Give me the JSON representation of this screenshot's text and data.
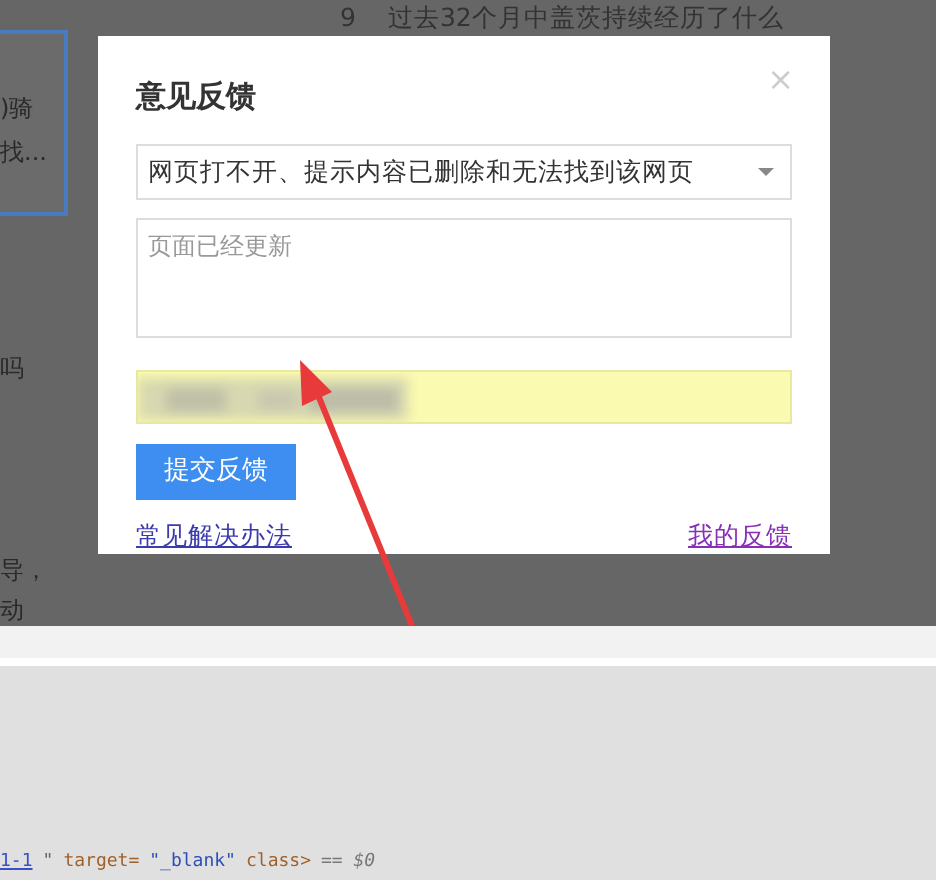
{
  "backdrop": {
    "headline_number": "9",
    "headline": "过去32个月中盖茨持续经历了什么",
    "card_lines": [
      ")骑",
      "找..."
    ],
    "fragments": [
      "吗",
      "导，",
      "动"
    ]
  },
  "dialog": {
    "title": "意见反馈",
    "close": "×",
    "select": {
      "value": "网页打不开、提示内容已删除和无法找到该网页"
    },
    "textarea": {
      "placeholder": "页面已经更新"
    },
    "submit": "提交反馈",
    "links": [
      {
        "text": "常见解决办法",
        "visited": false
      },
      {
        "text": "我的反馈",
        "visited": true
      }
    ]
  },
  "devtools": {
    "tokens": [
      {
        "text": "1-1",
        "kind": "link"
      },
      {
        "text": "\"",
        "kind": "plain"
      },
      {
        "text": "target=",
        "kind": "attr"
      },
      {
        "text": "\"_blank\"",
        "kind": "value"
      },
      {
        "text": "class>",
        "kind": "attr"
      },
      {
        "text": "== $0",
        "kind": "hint"
      }
    ]
  }
}
